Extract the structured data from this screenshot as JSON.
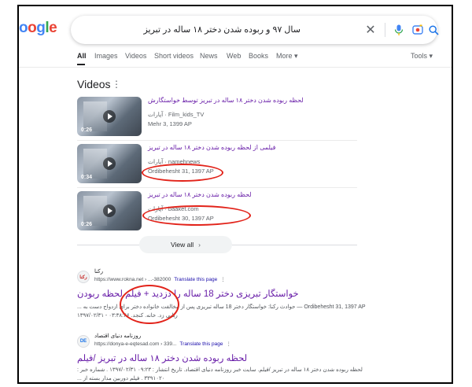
{
  "logo": [
    "o",
    "o",
    "g",
    "l",
    "e"
  ],
  "search": {
    "query": "سال ۹۷ و ربوده شدن دختر ۱۸ ساله در تبریز"
  },
  "tabs": [
    "All",
    "Images",
    "Videos",
    "Short videos",
    "News",
    "Web",
    "Books",
    "More ▾",
    "Tools ▾"
  ],
  "videos_section": {
    "title": "Videos",
    "items": [
      {
        "title": "لحظه ربوده شدن دختر ۱۸ ساله در تبریز توسط خواستگارش",
        "source": "آپارات · Film_kids_TV",
        "date": "Mehr 3, 1399 AP",
        "duration": "0:26"
      },
      {
        "title": "فیلمی از لحظه ربوده شدن دختر ۱۸ ساله در تبریز",
        "source": "آپارات · namehnews",
        "date": "Ordibehesht 31, 1397 AP",
        "duration": "0:34"
      },
      {
        "title": "لحظه ربوده شدن دختر ۱۸ ساله در تبریز",
        "source": "آپارات · baaket.com",
        "date": "Ordibehesht 30, 1397 AP",
        "duration": "0:26"
      }
    ],
    "view_all": "View all"
  },
  "results": [
    {
      "favicon": "رکنا",
      "site": "رکنا",
      "url": "https://www.rokna.net › ...-382000",
      "translate": "Translate this page",
      "title": "خواستگار تبریزی دختر 18 ساله را دزدید + فیلم لحظه ربودن",
      "snippet_date": "Ordibehesht 31, 1397 AP",
      "snippet_1": "حوادث رکنا: خواستگار دختر 18 ساله تبریزی پس از مخالفت خانواده دختر برای ازدواج دست به ...",
      "snippet_2": "ربایی زد. خانه. کنجد. ۰۳:۳۸:۴۶ - ۱۳۹۷/۰۲/۳۱"
    },
    {
      "favicon": "DE",
      "site": "روزنامه دنیای اقتصاد",
      "url": "https://donya-e-eqtesad.com › 339...",
      "translate": "Translate this page",
      "title": "لحظه ربوده شدن دختر ۱۸ ساله در تبریز /فیلم",
      "snippet_1": "لحظه ربوده شدن دختر ۱۸ ساله در تبریز /فیلم. سایت خبر روزنامه دنیای اقتصاد. تاریخ انتشار : ۰۹:۲۳ ۱۳۹۷/۰۲/۳۱ . شماره خبر :",
      "snippet_2": "۳۳۹۱۰۲۰ . فیلم دوربین مدار بسته از ..."
    }
  ],
  "colors": {
    "visited_link": "#681da8",
    "annotation": "#e2231a"
  }
}
